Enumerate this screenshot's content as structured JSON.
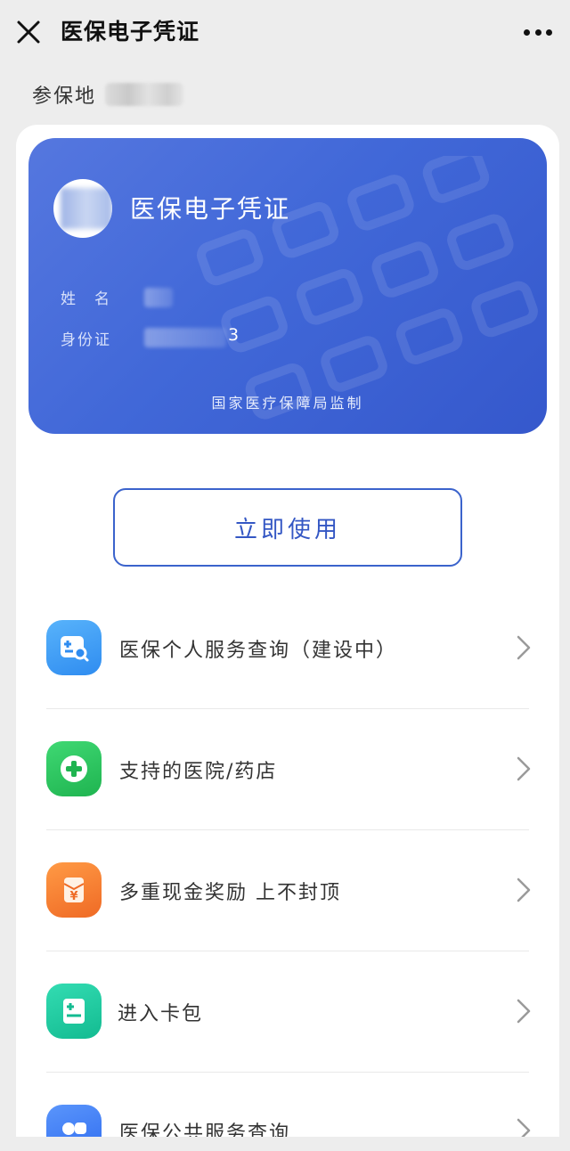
{
  "navbar": {
    "title": "医保电子凭证",
    "close_icon": "close-icon",
    "more_icon": "more-icon"
  },
  "location": {
    "label": "参保地"
  },
  "card": {
    "title": "医保电子凭证",
    "name_label": "姓　名",
    "id_label": "身份证",
    "id_tail": "3",
    "issuer": "国家医疗保障局监制",
    "colors": {
      "gradient_start": "#5577df",
      "gradient_end": "#3558cc"
    }
  },
  "use_button": {
    "label": "立即使用",
    "color": "#3457c4"
  },
  "menu": [
    {
      "label": "医保个人服务查询（建设中）",
      "icon": "medical-search-icon",
      "color": "#3d9cf5"
    },
    {
      "label": "支持的医院/药店",
      "icon": "hospital-cross-icon",
      "color": "#27c35f"
    },
    {
      "label": "多重现金奖励 上不封顶",
      "icon": "cash-reward-icon",
      "color": "#f2782f"
    },
    {
      "label": "进入卡包",
      "icon": "card-wallet-icon",
      "color": "#1ec9a0"
    },
    {
      "label": "医保公共服务查询",
      "icon": "public-service-icon",
      "color": "#3d7ef5"
    }
  ]
}
